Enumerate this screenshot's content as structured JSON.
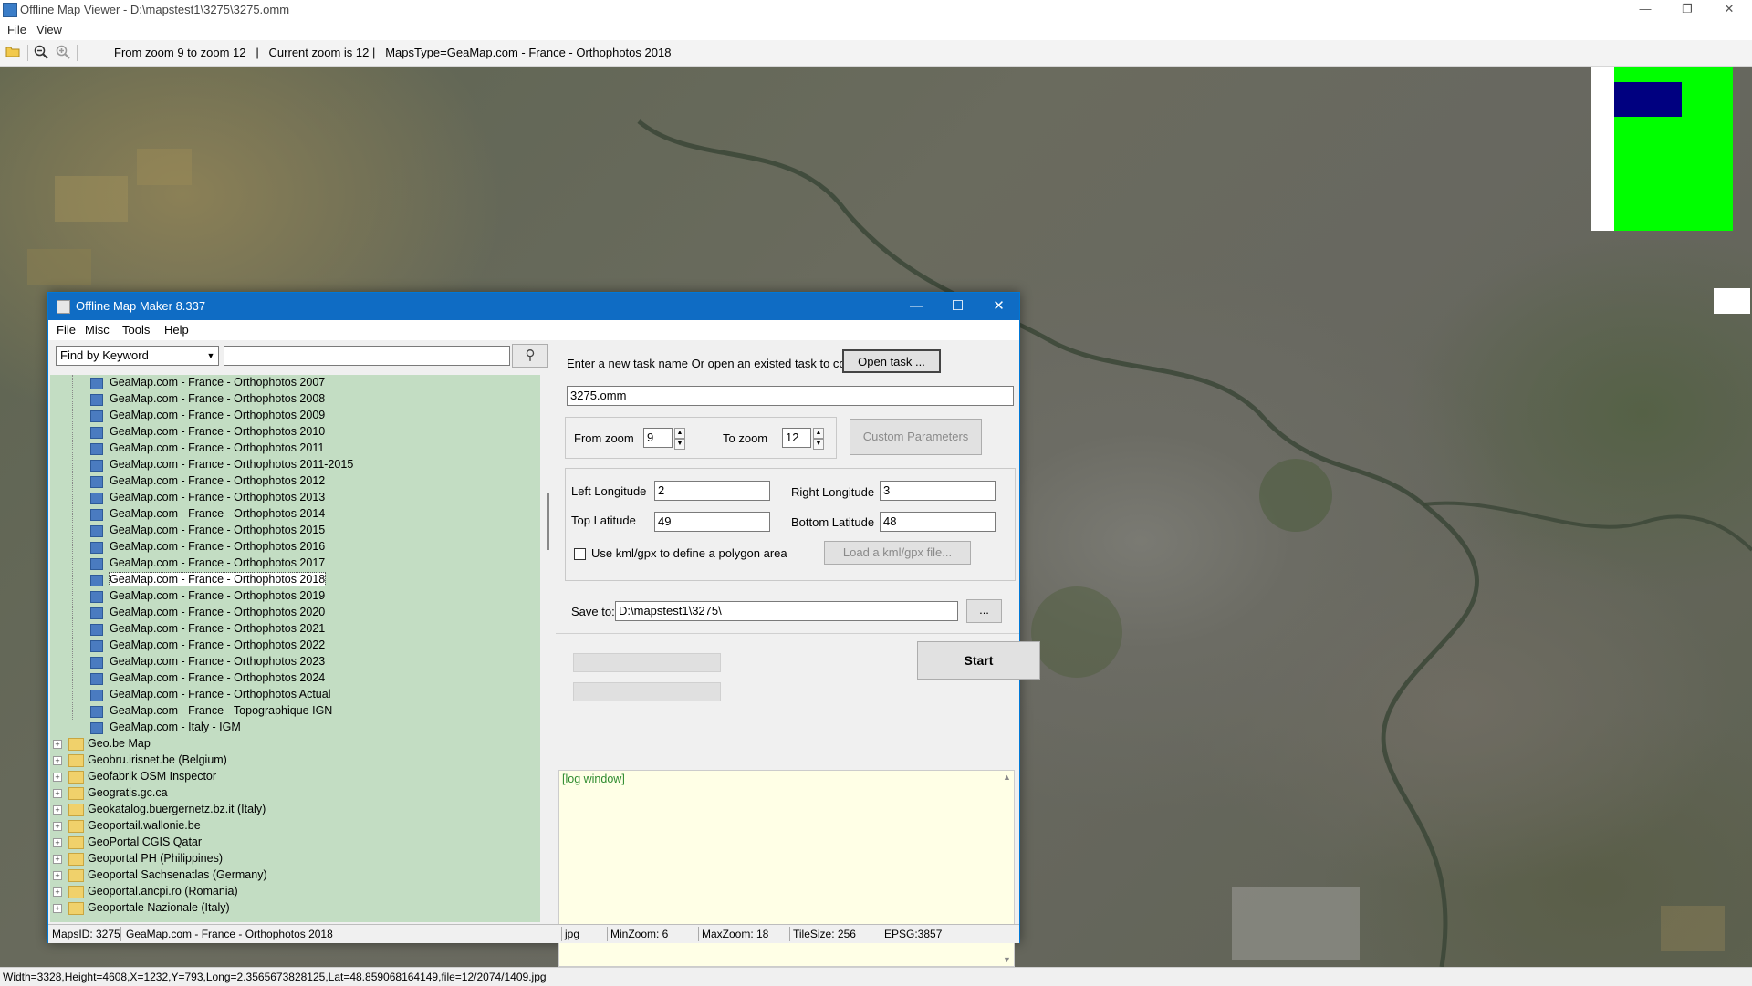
{
  "outer": {
    "title": "Offline Map Viewer - D:\\mapstest1\\3275\\3275.omm",
    "menu": [
      "File",
      "View"
    ],
    "toolbar_info": "From zoom 9 to zoom 12   |   Current zoom is 12 |   MapsType=GeaMap.com - France - Orthophotos 2018",
    "icons": [
      "open-folder-icon",
      "zoom-out-icon",
      "zoom-in-icon"
    ],
    "status": "Width=3328,Height=4608,X=1232,Y=793,Long=2.3565673828125,Lat=48.859068164149,file=12/2074/1409.jpg"
  },
  "inner": {
    "title": "Offline Map Maker 8.337",
    "menu": [
      "File",
      "Misc",
      "Tools",
      "Help"
    ],
    "find_select": "Find by Keyword",
    "find_input": "",
    "tree_maps": [
      "GeaMap.com - France - Orthophotos 2007",
      "GeaMap.com - France - Orthophotos 2008",
      "GeaMap.com - France - Orthophotos 2009",
      "GeaMap.com - France - Orthophotos 2010",
      "GeaMap.com - France - Orthophotos 2011",
      "GeaMap.com - France - Orthophotos 2011-2015",
      "GeaMap.com - France - Orthophotos 2012",
      "GeaMap.com - France - Orthophotos 2013",
      "GeaMap.com - France - Orthophotos 2014",
      "GeaMap.com - France - Orthophotos 2015",
      "GeaMap.com - France - Orthophotos 2016",
      "GeaMap.com - France - Orthophotos 2017",
      "GeaMap.com - France - Orthophotos 2018",
      "GeaMap.com - France - Orthophotos 2019",
      "GeaMap.com - France - Orthophotos 2020",
      "GeaMap.com - France - Orthophotos 2021",
      "GeaMap.com - France - Orthophotos 2022",
      "GeaMap.com - France - Orthophotos 2023",
      "GeaMap.com - France - Orthophotos 2024",
      "GeaMap.com - France - Orthophotos Actual",
      "GeaMap.com - France - Topographique IGN",
      "GeaMap.com - Italy - IGM"
    ],
    "selected_map": "GeaMap.com - France - Orthophotos 2018",
    "tree_folders": [
      "Geo.be Map",
      "Geobru.irisnet.be (Belgium)",
      "Geofabrik OSM Inspector",
      "Geogratis.gc.ca",
      "Geokatalog.buergernetz.bz.it (Italy)",
      "Geoportail.wallonie.be",
      "GeoPortal CGIS Qatar",
      "Geoportal PH (Philippines)",
      "Geoportal Sachsenatlas (Germany)",
      "Geoportal.ancpi.ro (Romania)",
      "Geoportale Nazionale (Italy)"
    ],
    "task_prompt": "Enter a new task name Or open an existed task to continue:",
    "open_task_label": "Open task ...",
    "task_name": "3275.omm",
    "from_zoom_label": "From zoom",
    "from_zoom_value": "9",
    "to_zoom_label": "To zoom",
    "to_zoom_value": "12",
    "custom_params_label": "Custom Parameters",
    "left_lon_label": "Left Longitude",
    "left_lon_value": "2",
    "right_lon_label": "Right Longitude",
    "right_lon_value": "3",
    "top_lat_label": "Top Latitude",
    "top_lat_value": "49",
    "bottom_lat_label": "Bottom Latitude",
    "bottom_lat_value": "48",
    "kml_checkbox_label": "Use kml/gpx to define a polygon area",
    "kml_checked": false,
    "load_kml_label": "Load a kml/gpx file...",
    "save_to_label": "Save to:",
    "save_to_value": "D:\\mapstest1\\3275\\",
    "browse_label": "...",
    "start_label": "Start",
    "log_text": "[log window]",
    "status": {
      "maps_id": "MapsID: 3275",
      "map_name": "GeaMap.com - France - Orthophotos 2018",
      "format": "jpg",
      "min_zoom": "MinZoom: 6",
      "max_zoom": "MaxZoom: 18",
      "tile_size": "TileSize: 256",
      "epsg": "EPSG:3857"
    }
  },
  "colors": {
    "inner_titlebar": "#0f6cc4",
    "tree_background": "#c3ddc3",
    "log_background": "#ffffe6",
    "overview_green": "#00ff00",
    "overview_blue": "#000080"
  }
}
